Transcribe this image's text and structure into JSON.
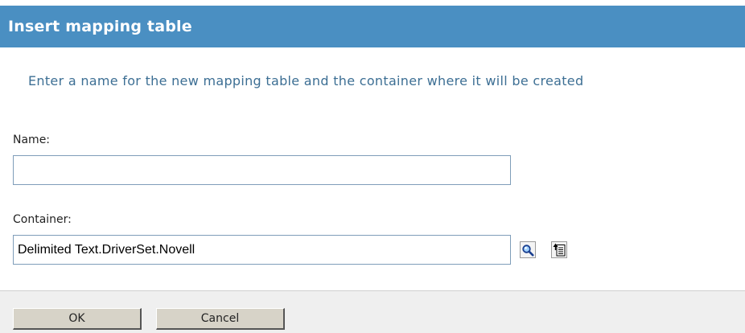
{
  "dialog": {
    "title": "Insert mapping table",
    "instruction": "Enter a name for the new mapping table and the container where it will be created"
  },
  "fields": {
    "name": {
      "label": "Name:",
      "value": ""
    },
    "container": {
      "label": "Container:",
      "value": "Delimited Text.DriverSet.Novell"
    }
  },
  "icons": {
    "search": "search-icon",
    "browse": "object-browser-icon"
  },
  "buttons": {
    "ok": "OK",
    "cancel": "Cancel"
  },
  "colors": {
    "title_bar": "#4a8fc2",
    "instruction_text": "#3d6f94",
    "button_face": "#d7d3c8"
  }
}
